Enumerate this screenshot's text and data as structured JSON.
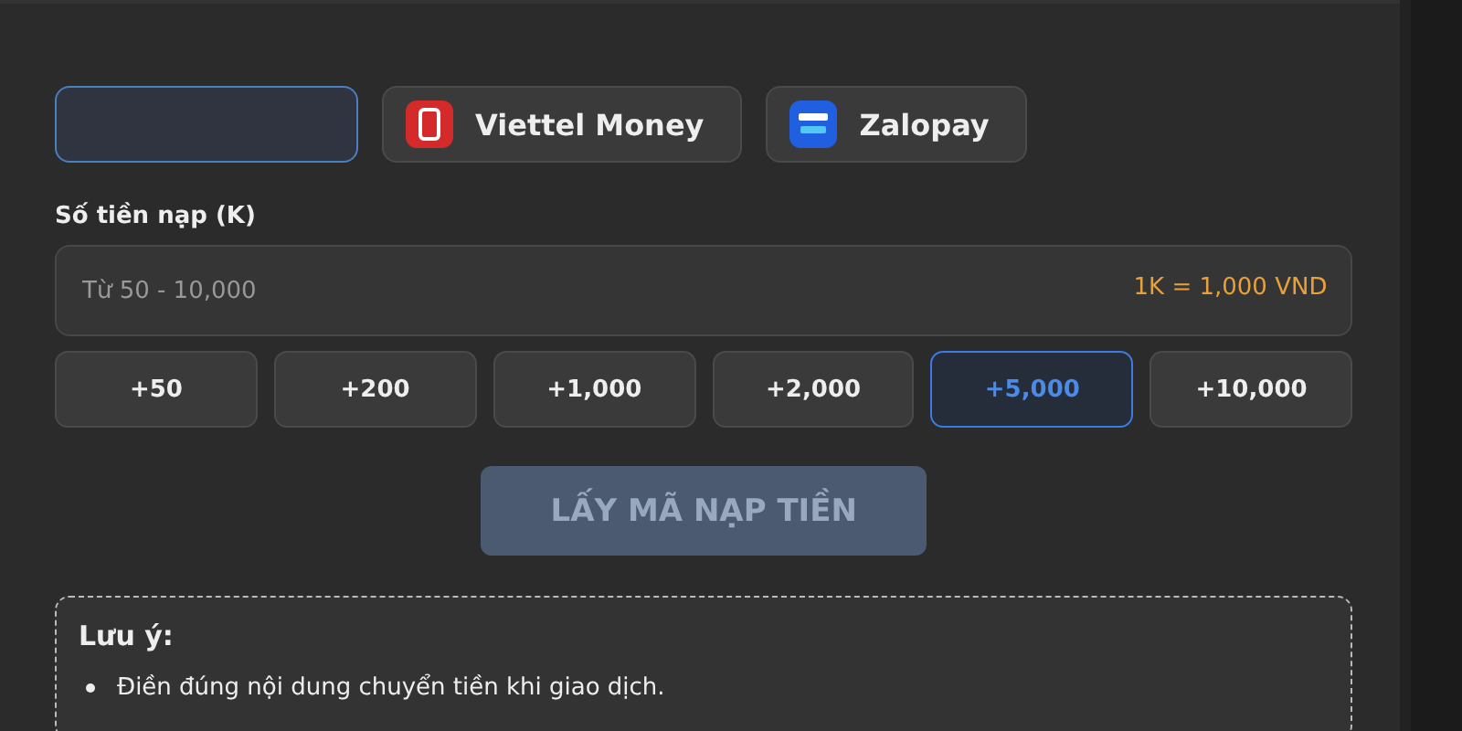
{
  "methods": [
    {
      "kind": "blank",
      "selected": true
    },
    {
      "kind": "viettel",
      "label": "Viettel Money",
      "selected": false
    },
    {
      "kind": "zalopay",
      "label": "Zalopay",
      "selected": false
    }
  ],
  "amount": {
    "label": "Số tiền nạp (K)",
    "placeholder": "Từ 50 - 10,000",
    "rate": "1K = 1,000 VND"
  },
  "presets": [
    {
      "label": "+50",
      "selected": false
    },
    {
      "label": "+200",
      "selected": false
    },
    {
      "label": "+1,000",
      "selected": false
    },
    {
      "label": "+2,000",
      "selected": false
    },
    {
      "label": "+5,000",
      "selected": true
    },
    {
      "label": "+10,000",
      "selected": false
    }
  ],
  "submit": {
    "label": "LẤY MÃ NẠP TIỀN",
    "disabled": true
  },
  "note": {
    "title": "Lưu ý:",
    "items": [
      "Điền đúng nội dung chuyển tiền khi giao dịch."
    ]
  }
}
